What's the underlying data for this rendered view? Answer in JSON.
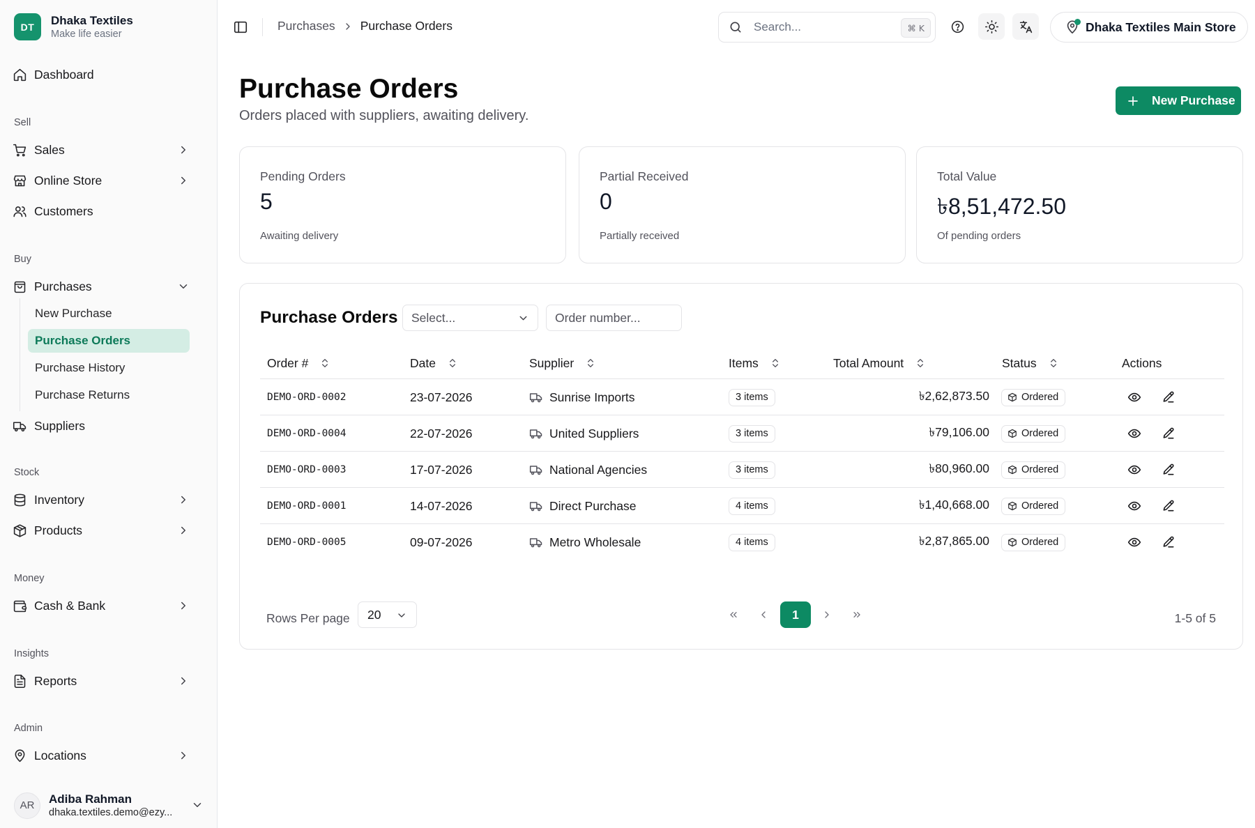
{
  "brand": {
    "initials": "DT",
    "name": "Dhaka Textiles",
    "tagline": "Make life easier"
  },
  "sidebar": {
    "dashboard": "Dashboard",
    "sections": {
      "sell": "Sell",
      "buy": "Buy",
      "stock": "Stock",
      "money": "Money",
      "insights": "Insights",
      "admin": "Admin"
    },
    "items": {
      "sales": "Sales",
      "online_store": "Online Store",
      "customers": "Customers",
      "purchases": "Purchases",
      "suppliers": "Suppliers",
      "inventory": "Inventory",
      "products": "Products",
      "cash_bank": "Cash & Bank",
      "reports": "Reports",
      "locations": "Locations"
    },
    "purchases_sub": [
      "New Purchase",
      "Purchase Orders",
      "Purchase History",
      "Purchase Returns"
    ],
    "active_sub": "Purchase Orders"
  },
  "user": {
    "initials": "AR",
    "name": "Adiba Rahman",
    "email": "dhaka.textiles.demo@ezy..."
  },
  "header": {
    "breadcrumb": [
      "Purchases",
      "Purchase Orders"
    ],
    "search_placeholder": "Search...",
    "search_shortcut": "⌘ K",
    "store": "Dhaka Textiles Main Store",
    "icons": [
      "sidebar-toggle-icon",
      "help-icon",
      "sun-icon",
      "translate-icon",
      "location-pin-icon"
    ]
  },
  "page": {
    "title": "Purchase Orders",
    "subtitle": "Orders placed with suppliers, awaiting delivery.",
    "new_button": "New Purchase"
  },
  "stats": [
    {
      "label": "Pending Orders",
      "value": "5",
      "note": "Awaiting delivery"
    },
    {
      "label": "Partial Received",
      "value": "0",
      "note": "Partially received"
    },
    {
      "label": "Total Value",
      "value": "৳8,51,472.50",
      "note": "Of pending orders"
    }
  ],
  "table": {
    "title": "Purchase Orders",
    "filter_select_placeholder": "Select...",
    "order_search_placeholder": "Order number...",
    "columns": {
      "order": "Order #",
      "date": "Date",
      "supplier": "Supplier",
      "items": "Items",
      "amount": "Total Amount",
      "status": "Status",
      "actions": "Actions"
    },
    "rows": [
      {
        "order": "DEMO-ORD-0002",
        "date": "23-07-2026",
        "supplier": "Sunrise Imports",
        "items": "3 items",
        "amount": "৳2,62,873.50",
        "status": "Ordered"
      },
      {
        "order": "DEMO-ORD-0004",
        "date": "22-07-2026",
        "supplier": "United Suppliers",
        "items": "3 items",
        "amount": "৳79,106.00",
        "status": "Ordered"
      },
      {
        "order": "DEMO-ORD-0003",
        "date": "17-07-2026",
        "supplier": "National Agencies",
        "items": "3 items",
        "amount": "৳80,960.00",
        "status": "Ordered"
      },
      {
        "order": "DEMO-ORD-0001",
        "date": "14-07-2026",
        "supplier": "Direct Purchase",
        "items": "4 items",
        "amount": "৳1,40,668.00",
        "status": "Ordered"
      },
      {
        "order": "DEMO-ORD-0005",
        "date": "09-07-2026",
        "supplier": "Metro Wholesale",
        "items": "4 items",
        "amount": "৳2,87,865.00",
        "status": "Ordered"
      }
    ],
    "pagination": {
      "rows_label": "Rows Per page",
      "rows_per_page": "20",
      "current_page": "1",
      "info": "1-5 of 5"
    }
  },
  "colors": {
    "brand": "#15936d",
    "primary_button": "#0d8a63",
    "active_bg": "#d4ede4",
    "active_text": "#0d7a59"
  }
}
